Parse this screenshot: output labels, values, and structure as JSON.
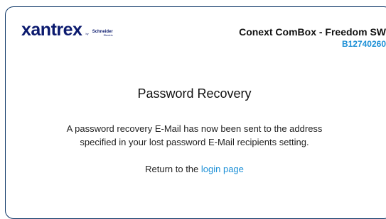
{
  "logo": {
    "brand": "xantrex",
    "by": "by",
    "partner": "Schneider",
    "partner_sub": "Electric"
  },
  "device": {
    "name": "Conext ComBox - Freedom SW",
    "serial": "B12740260"
  },
  "page": {
    "heading": "Password Recovery",
    "message_line1": "A password recovery E-Mail has now been sent to the address",
    "message_line2": "specified in your lost password E-Mail recipients setting.",
    "return_prefix": "Return to the",
    "login_link": "login page"
  },
  "colors": {
    "border": "#0b3566",
    "brand": "#0b1a6e",
    "link": "#1b8fd6"
  }
}
